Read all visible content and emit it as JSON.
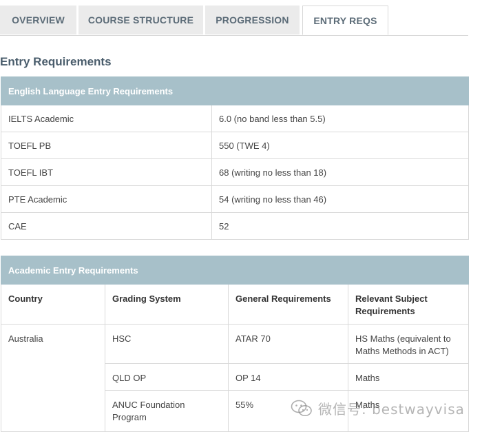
{
  "tabs": [
    {
      "label": "OVERVIEW",
      "active": false
    },
    {
      "label": "COURSE STRUCTURE",
      "active": false
    },
    {
      "label": "PROGRESSION",
      "active": false
    },
    {
      "label": "ENTRY REQS",
      "active": true
    }
  ],
  "page_title": "Entry Requirements",
  "english": {
    "header": "English Language Entry Requirements",
    "rows": [
      {
        "test": "IELTS Academic",
        "score": "6.0 (no band less than 5.5)"
      },
      {
        "test": "TOEFL PB",
        "score": "550 (TWE 4)"
      },
      {
        "test": "TOEFL IBT",
        "score": "68 (writing no less than 18)"
      },
      {
        "test": "PTE Academic",
        "score": "54 (writing no less than 46)"
      },
      {
        "test": "CAE",
        "score": "52"
      }
    ]
  },
  "academic": {
    "header": "Academic Entry Requirements",
    "columns": [
      "Country",
      "Grading System",
      "General Requirements",
      "Relevant Subject Requirements"
    ],
    "rows": [
      {
        "country": "Australia",
        "grading": "HSC",
        "general": "ATAR 70",
        "subject": "HS Maths (equivalent to Maths Methods in ACT)"
      },
      {
        "country": "",
        "grading": "QLD OP",
        "general": "OP 14",
        "subject": "Maths"
      },
      {
        "country": "",
        "grading": "ANUC Foundation Program",
        "general": "55%",
        "subject": "Maths"
      }
    ]
  },
  "watermark": {
    "text": "微信号: bestwayvisa",
    "icon": "wechat-icon"
  }
}
